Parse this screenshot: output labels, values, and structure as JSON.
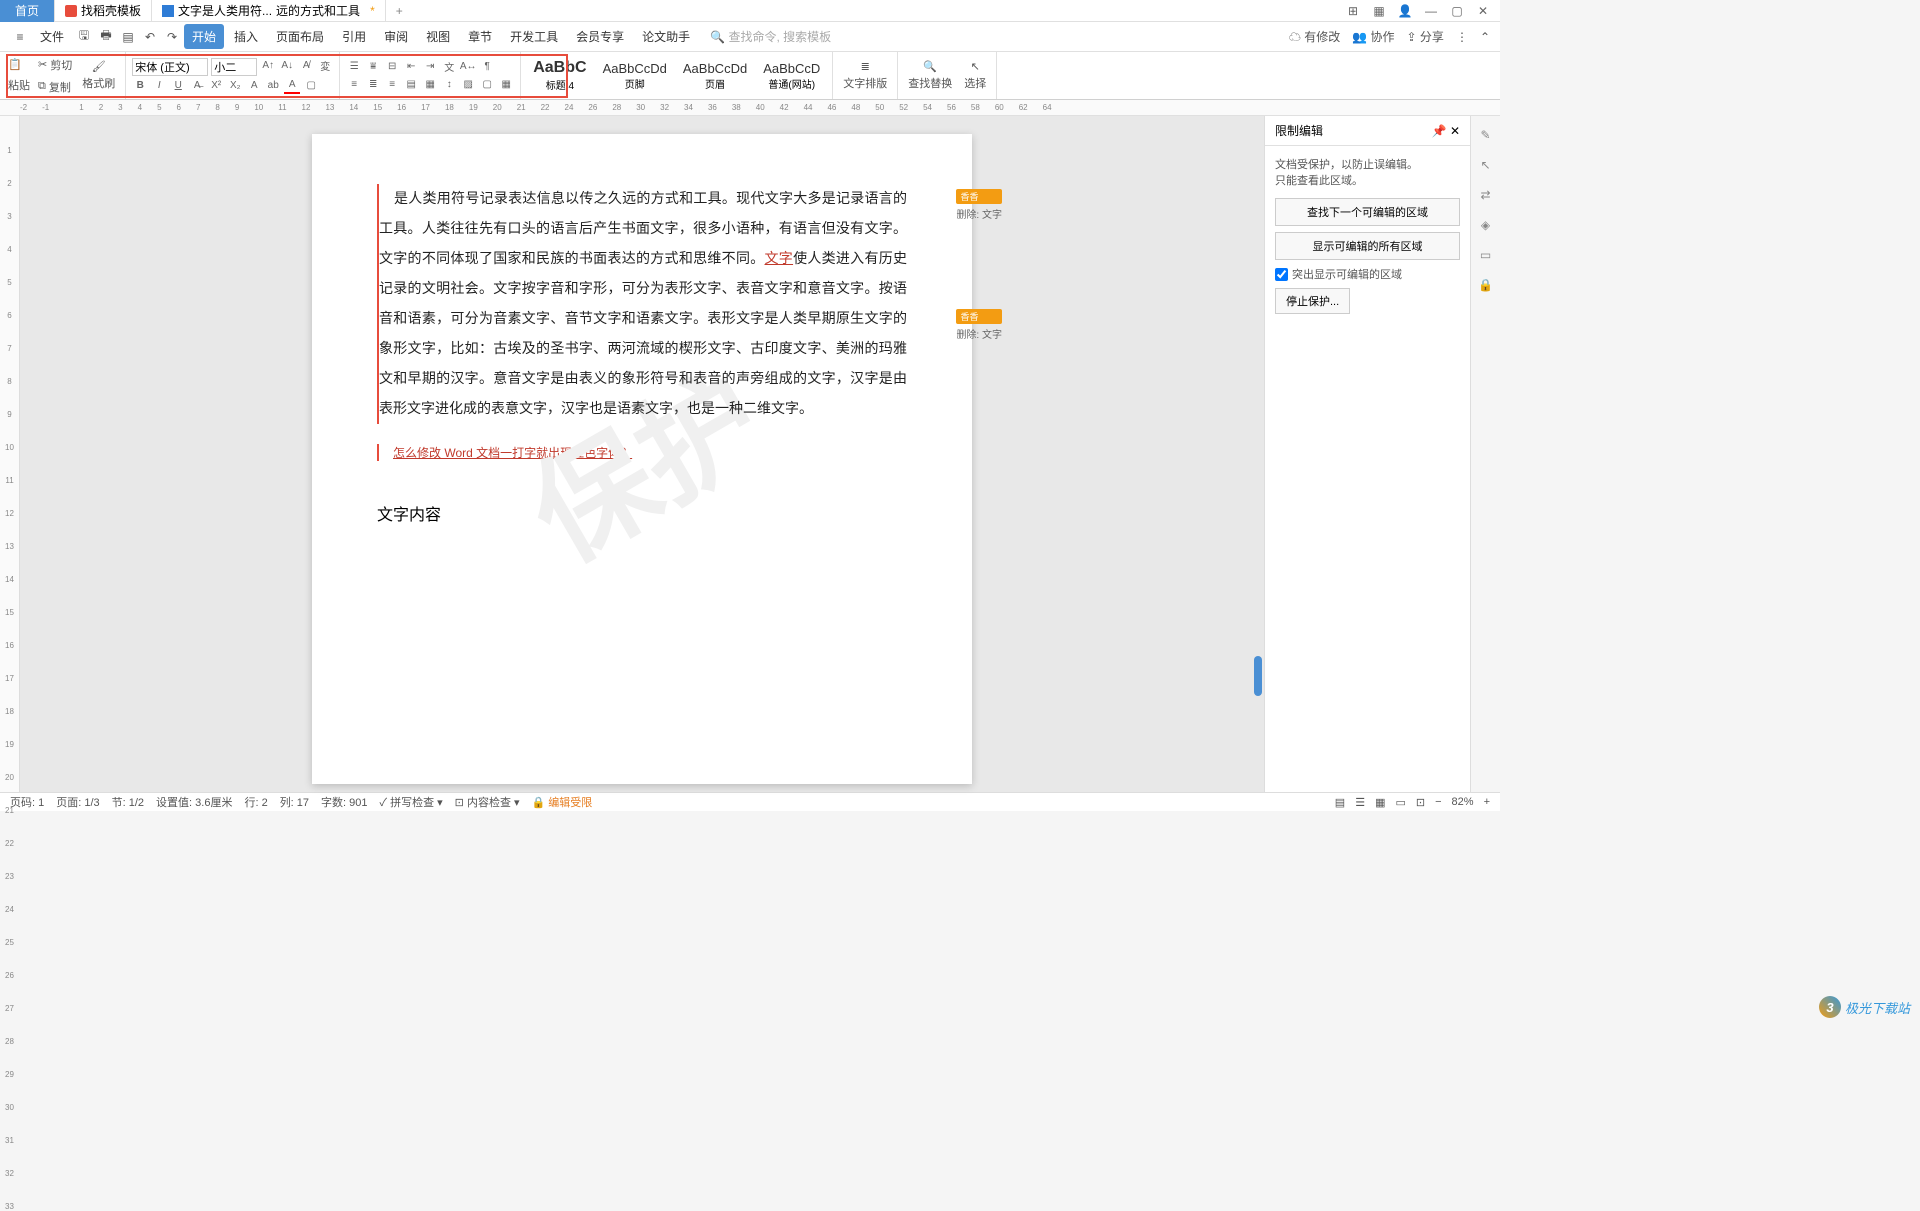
{
  "titlebar": {
    "home": "首页",
    "tab1": "找稻壳模板",
    "tab2_prefix": "文字是人类用符...",
    "tab2_suffix": "远的方式和工具",
    "modified": "*"
  },
  "menubar": {
    "file": "文件",
    "items": [
      "开始",
      "插入",
      "页面布局",
      "引用",
      "审阅",
      "视图",
      "章节",
      "开发工具",
      "会员专享",
      "论文助手"
    ],
    "search_cmd": "查找命令,",
    "search_tpl": "搜索模板",
    "right": {
      "changes": "有修改",
      "collab": "协作",
      "share": "分享"
    }
  },
  "toolbar": {
    "cut": "剪切",
    "copy": "复制",
    "paste": "粘贴",
    "fmt_painter": "格式刷",
    "font": "宋体 (正文)",
    "size": "小二",
    "styles": [
      {
        "preview": "AaBbC",
        "name": "标题 4"
      },
      {
        "preview": "AaBbCcDd",
        "name": "页脚"
      },
      {
        "preview": "AaBbCcDd",
        "name": "页眉"
      },
      {
        "preview": "AaBbCcD",
        "name": "普通(网站)"
      }
    ],
    "text_layout": "文字排版",
    "find_replace": "查找替换",
    "select": "选择"
  },
  "ruler_ticks": [
    -2,
    -1,
    "",
    1,
    2,
    3,
    4,
    5,
    6,
    7,
    8,
    9,
    10,
    11,
    12,
    13,
    14,
    15,
    16,
    17,
    18,
    19,
    20,
    21,
    22,
    24,
    26,
    28,
    30,
    32,
    34,
    36,
    38,
    40,
    42,
    44,
    46,
    48,
    50,
    52,
    54,
    56,
    58,
    60,
    62,
    64
  ],
  "vruler": [
    1,
    2,
    3,
    4,
    5,
    6,
    7,
    8,
    9,
    10,
    11,
    12,
    13,
    14,
    15,
    16,
    17,
    18,
    19,
    20,
    21,
    22,
    23,
    24,
    25,
    26,
    27,
    28,
    29,
    30,
    31,
    32,
    33
  ],
  "doc": {
    "watermark": "保护",
    "p1a": "是人类用符号记录表达信息以传之久远的方式和工具。现代文字大多是记录语言的工具。人类往往先有口头的语言后产生书面文字，很多小语种，有语言但没有文字。文字的不同体现了国家和民族的书面表达的方式和思维不同。",
    "link": "文字",
    "p1b": "使人类进入有历史记录的文明社会。文字按字音和字形，可分为表形文字、表音文字和意音文字。按语音和语素，可分为音素文字、音节文字和语素文字。表形文字是人类早期原生文字的象形文字，比如：古埃及的圣书字、两河流域的楔形文字、古印度文字、美洲的玛雅文和早期的汉字。意音文字是由表义的象形符号和表音的声旁组成的文字，汉字是由表形文字进化成的表意文字，汉字也是语素文字，也是一种二维文字。",
    "question": "怎么修改 Word 文档一打字就出现红色字体？",
    "heading": "文字内容"
  },
  "comments": {
    "author": "香香",
    "action": "删除: 文字"
  },
  "panel": {
    "title": "限制编辑",
    "msg1": "文档受保护，以防止误编辑。",
    "msg2": "只能查看此区域。",
    "btn1": "查找下一个可编辑的区域",
    "btn2": "显示可编辑的所有区域",
    "chk": "突出显示可编辑的区域",
    "btn3": "停止保护..."
  },
  "statusbar": {
    "page": "页码: 1",
    "pages": "页面: 1/3",
    "sections": "节: 1/2",
    "pos": "设置值: 3.6厘米",
    "line": "行: 2",
    "col": "列: 17",
    "words": "字数: 901",
    "spell": "拼写检查",
    "content": "内容检查",
    "restricted": "编辑受限",
    "zoom": "82%"
  },
  "logo": "极光下载站"
}
